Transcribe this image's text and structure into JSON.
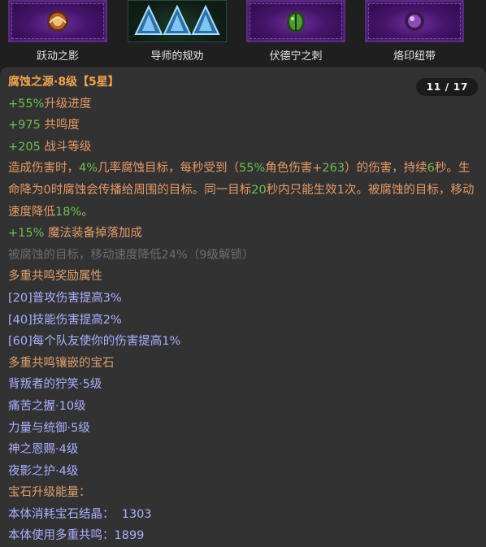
{
  "gems": [
    {
      "name": "跃动之影",
      "icon": "orange-swirl-gem-icon"
    },
    {
      "name": "导师的规劝",
      "icon": "triple-blue-pyramid-gem-icon"
    },
    {
      "name": "伏德宁之刺",
      "icon": "green-beetle-gem-icon"
    },
    {
      "name": "烙印纽带",
      "icon": "purple-orb-gem-icon"
    }
  ],
  "detail": {
    "title": "腐蚀之源·8级",
    "stars": "【5星】",
    "page": "11 / 17",
    "stats": [
      {
        "plus": "+55%",
        "label": "升级进度"
      },
      {
        "plus": "+975",
        "label": " 共鸣度"
      },
      {
        "plus": "+205",
        "label": " 战斗等级"
      }
    ],
    "desc_parts": [
      "造成伤害时，",
      "4%",
      "几率腐蚀目标，每秒受到（",
      "55%",
      "角色伤害+",
      "263",
      "）的伤害，持续",
      "6",
      "秒。生命降为0时腐蚀会传播给周围的目标。同一目标",
      "20",
      "秒内只能生效1次。被腐蚀的目标，移动速度降低",
      "18%",
      "。"
    ],
    "magic_drop_plus": "+15%",
    "magic_drop_label": " 魔法装备掉落加成",
    "locked_text": "被腐蚀的目标，移动速度降低24%（9级解锁）",
    "resonance_heading": "多重共鸣奖励属性",
    "resonance_bonuses": [
      "[20]普攻伤害提高3%",
      "[40]技能伤害提高2%",
      "[60]每个队友使你的伤害提高1%"
    ],
    "socket_heading": "多重共鸣镶嵌的宝石",
    "socketed_gems": [
      "背叛者的狞笑·5级",
      "痛苦之握·10级",
      "力量与统御·5级",
      "神之恩赐·4级",
      "夜影之护·4级"
    ],
    "upgrade_heading": "宝石升级能量：",
    "cost_crystal": "本体消耗宝石结晶：  1303",
    "cost_resonance": "本体使用多重共鸣：1899"
  },
  "colors": {
    "title": "#f0a44b",
    "stat": "#e59a63",
    "number": "#6fc04a",
    "bonus": "#a9b0ff",
    "locked": "#6c6c6c",
    "panel": "#323232"
  }
}
